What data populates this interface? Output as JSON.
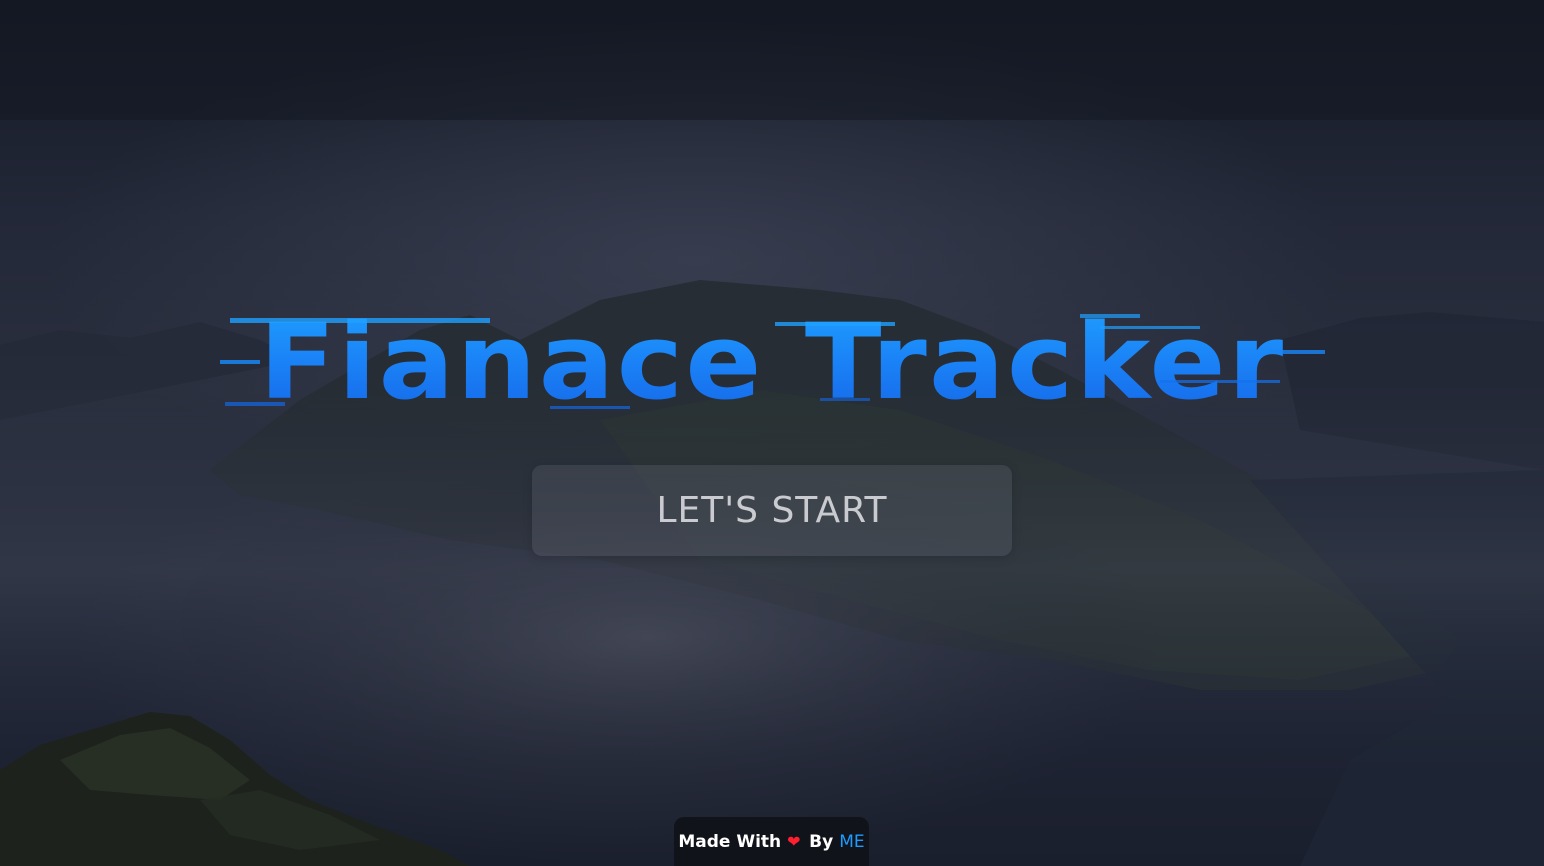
{
  "hero": {
    "title": "Fianace Tracker",
    "start_button_label": "LET'S START"
  },
  "footer": {
    "made_with": "Made With",
    "heart_icon": "heart-icon",
    "by": "By",
    "author": "ME"
  },
  "colors": {
    "title_gradient_top": "#1fa0ff",
    "title_gradient_bottom": "#1466e6",
    "heart": "#ff1f2e",
    "author_link": "#1e9bff",
    "button_text": "#c9cbd0"
  }
}
